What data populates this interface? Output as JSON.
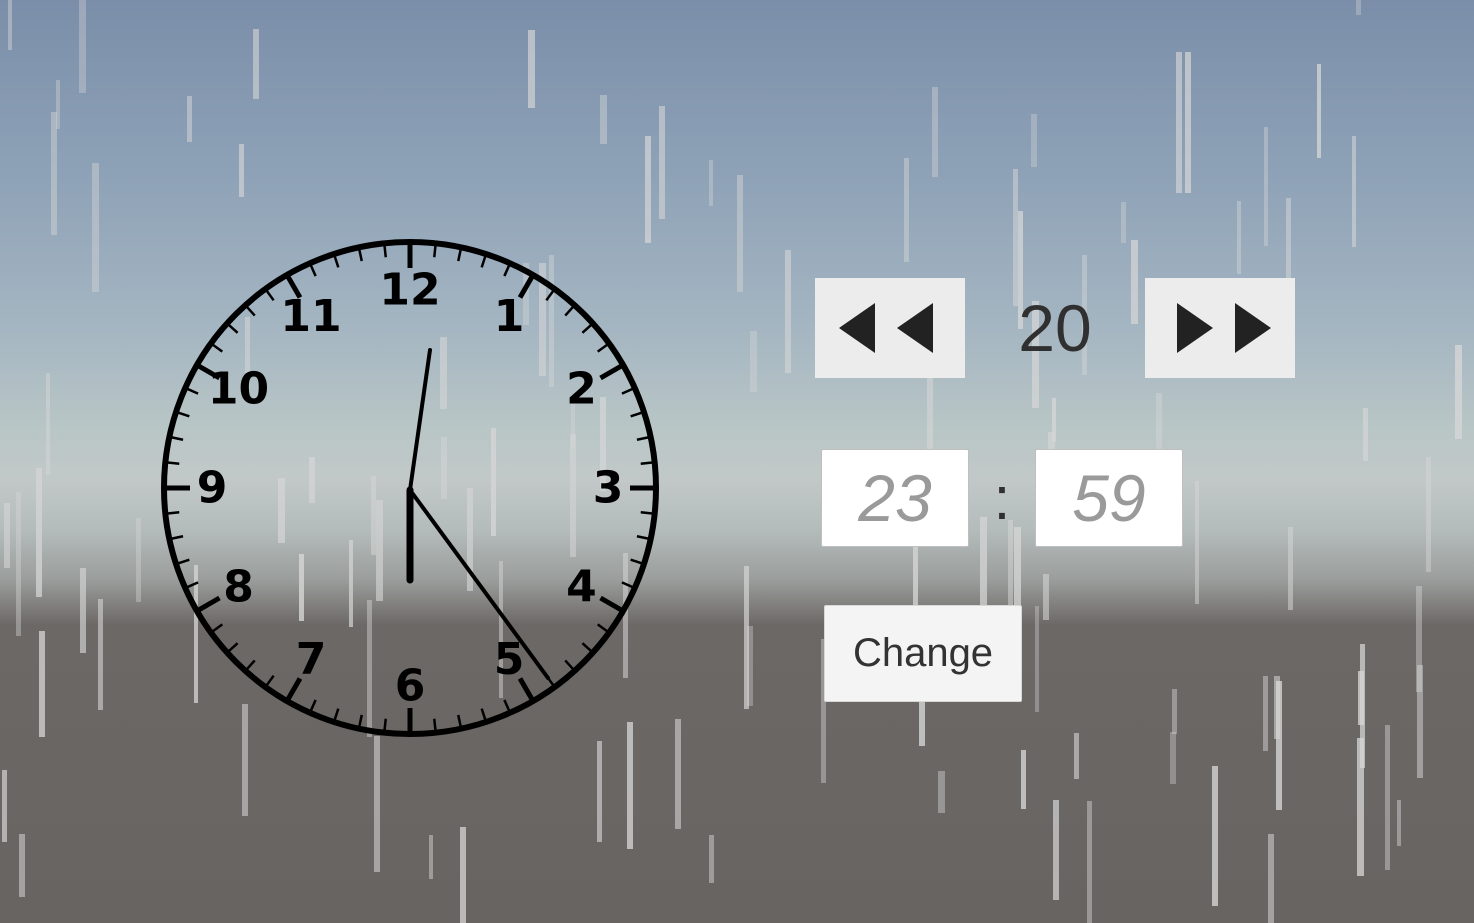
{
  "time_controls": {
    "speed_value": "20",
    "rewind_icon": "rewind-icon",
    "fast_forward_icon": "fast-forward-icon"
  },
  "time_input": {
    "hour_placeholder": "23",
    "minute_placeholder": "59",
    "separator": ":"
  },
  "change_button": {
    "label": "Change"
  },
  "clock": {
    "numbers": [
      "12",
      "1",
      "2",
      "3",
      "4",
      "5",
      "6",
      "7",
      "8",
      "9",
      "10",
      "11"
    ],
    "time_shown": "17:59"
  },
  "colors": {
    "clock_ink": "#000000",
    "button_bg": "#ececec",
    "icon_color": "#222222",
    "rain": "#d6d6d6"
  }
}
